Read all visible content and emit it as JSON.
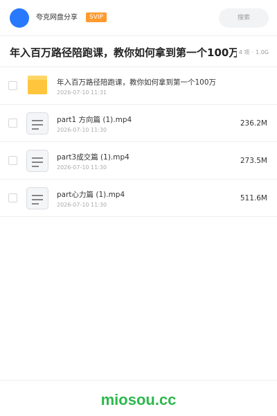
{
  "header": {
    "username": "夸克网盘分享",
    "badge": "SVIP",
    "search_placeholder": "搜索"
  },
  "folder": {
    "title": "年入百万路径陪跑课，教你如何拿到第一个100万",
    "item_count": "4 项",
    "total_size": "1.0G"
  },
  "files": [
    {
      "type": "folder",
      "icon": "folder-icon",
      "name": "年入百万路径陪跑课，教你如何拿到第一个100万",
      "date": "2026-07-10 11:31",
      "size": ""
    },
    {
      "type": "video",
      "icon": "file-icon",
      "name": "part1 方向篇 (1).mp4",
      "date": "2026-07-10 11:30",
      "size": "236.2M"
    },
    {
      "type": "video",
      "icon": "file-icon",
      "name": "part3成交篇 (1).mp4",
      "date": "2026-07-10 11:30",
      "size": "273.5M"
    },
    {
      "type": "video",
      "icon": "file-icon",
      "name": "part心力篇 (1).mp4",
      "date": "2026-07-10 11:30",
      "size": "511.6M"
    }
  ],
  "watermark": "miosou.cc",
  "colors": {
    "avatar": "#2979ff",
    "badge": "#ff9a2e",
    "folder_yellow": "#ffc53d",
    "folder_tab": "#ffd666",
    "watermark": "#2db84d"
  }
}
